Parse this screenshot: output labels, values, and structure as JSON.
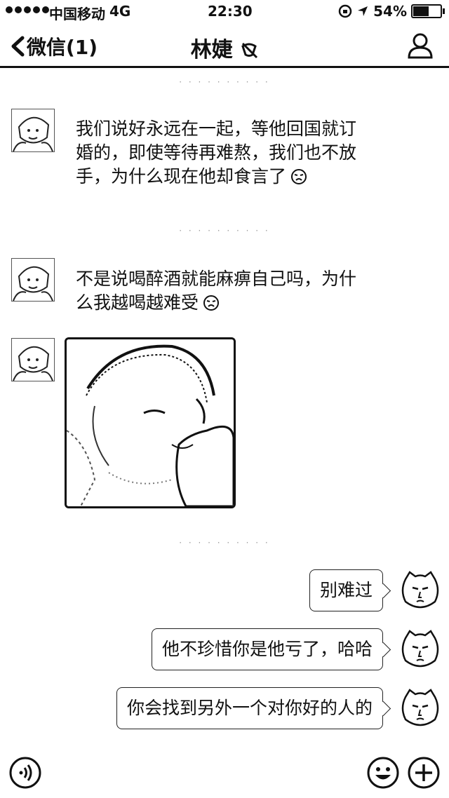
{
  "status_bar": {
    "carrier": "中国移动",
    "network": "4G",
    "time": "22:30",
    "battery": "54%"
  },
  "nav": {
    "back_label": "微信(1)",
    "title": "林婕"
  },
  "messages": [
    {
      "side": "left",
      "type": "text",
      "text": "我们说好永远在一起，等他回国就订\n婚的，即使等待再难熬，我们也不放\n手，为什么现在他却食言了"
    },
    {
      "side": "left",
      "type": "text",
      "text": "不是说喝醉酒就能麻痹自己吗，为什\n么我越喝越难受"
    },
    {
      "side": "left",
      "type": "image",
      "icon": "crying-girl-photo"
    },
    {
      "side": "right",
      "type": "text",
      "text": "别难过"
    },
    {
      "side": "right",
      "type": "text",
      "text": "他不珍惜你是他亏了，哈哈"
    },
    {
      "side": "right",
      "type": "text",
      "text": "你会找到另外一个对你好的人的"
    }
  ],
  "icons": {
    "voice": "voice-input-icon",
    "emoji": "emoji-icon",
    "more": "plus-icon",
    "profile": "profile-icon"
  }
}
